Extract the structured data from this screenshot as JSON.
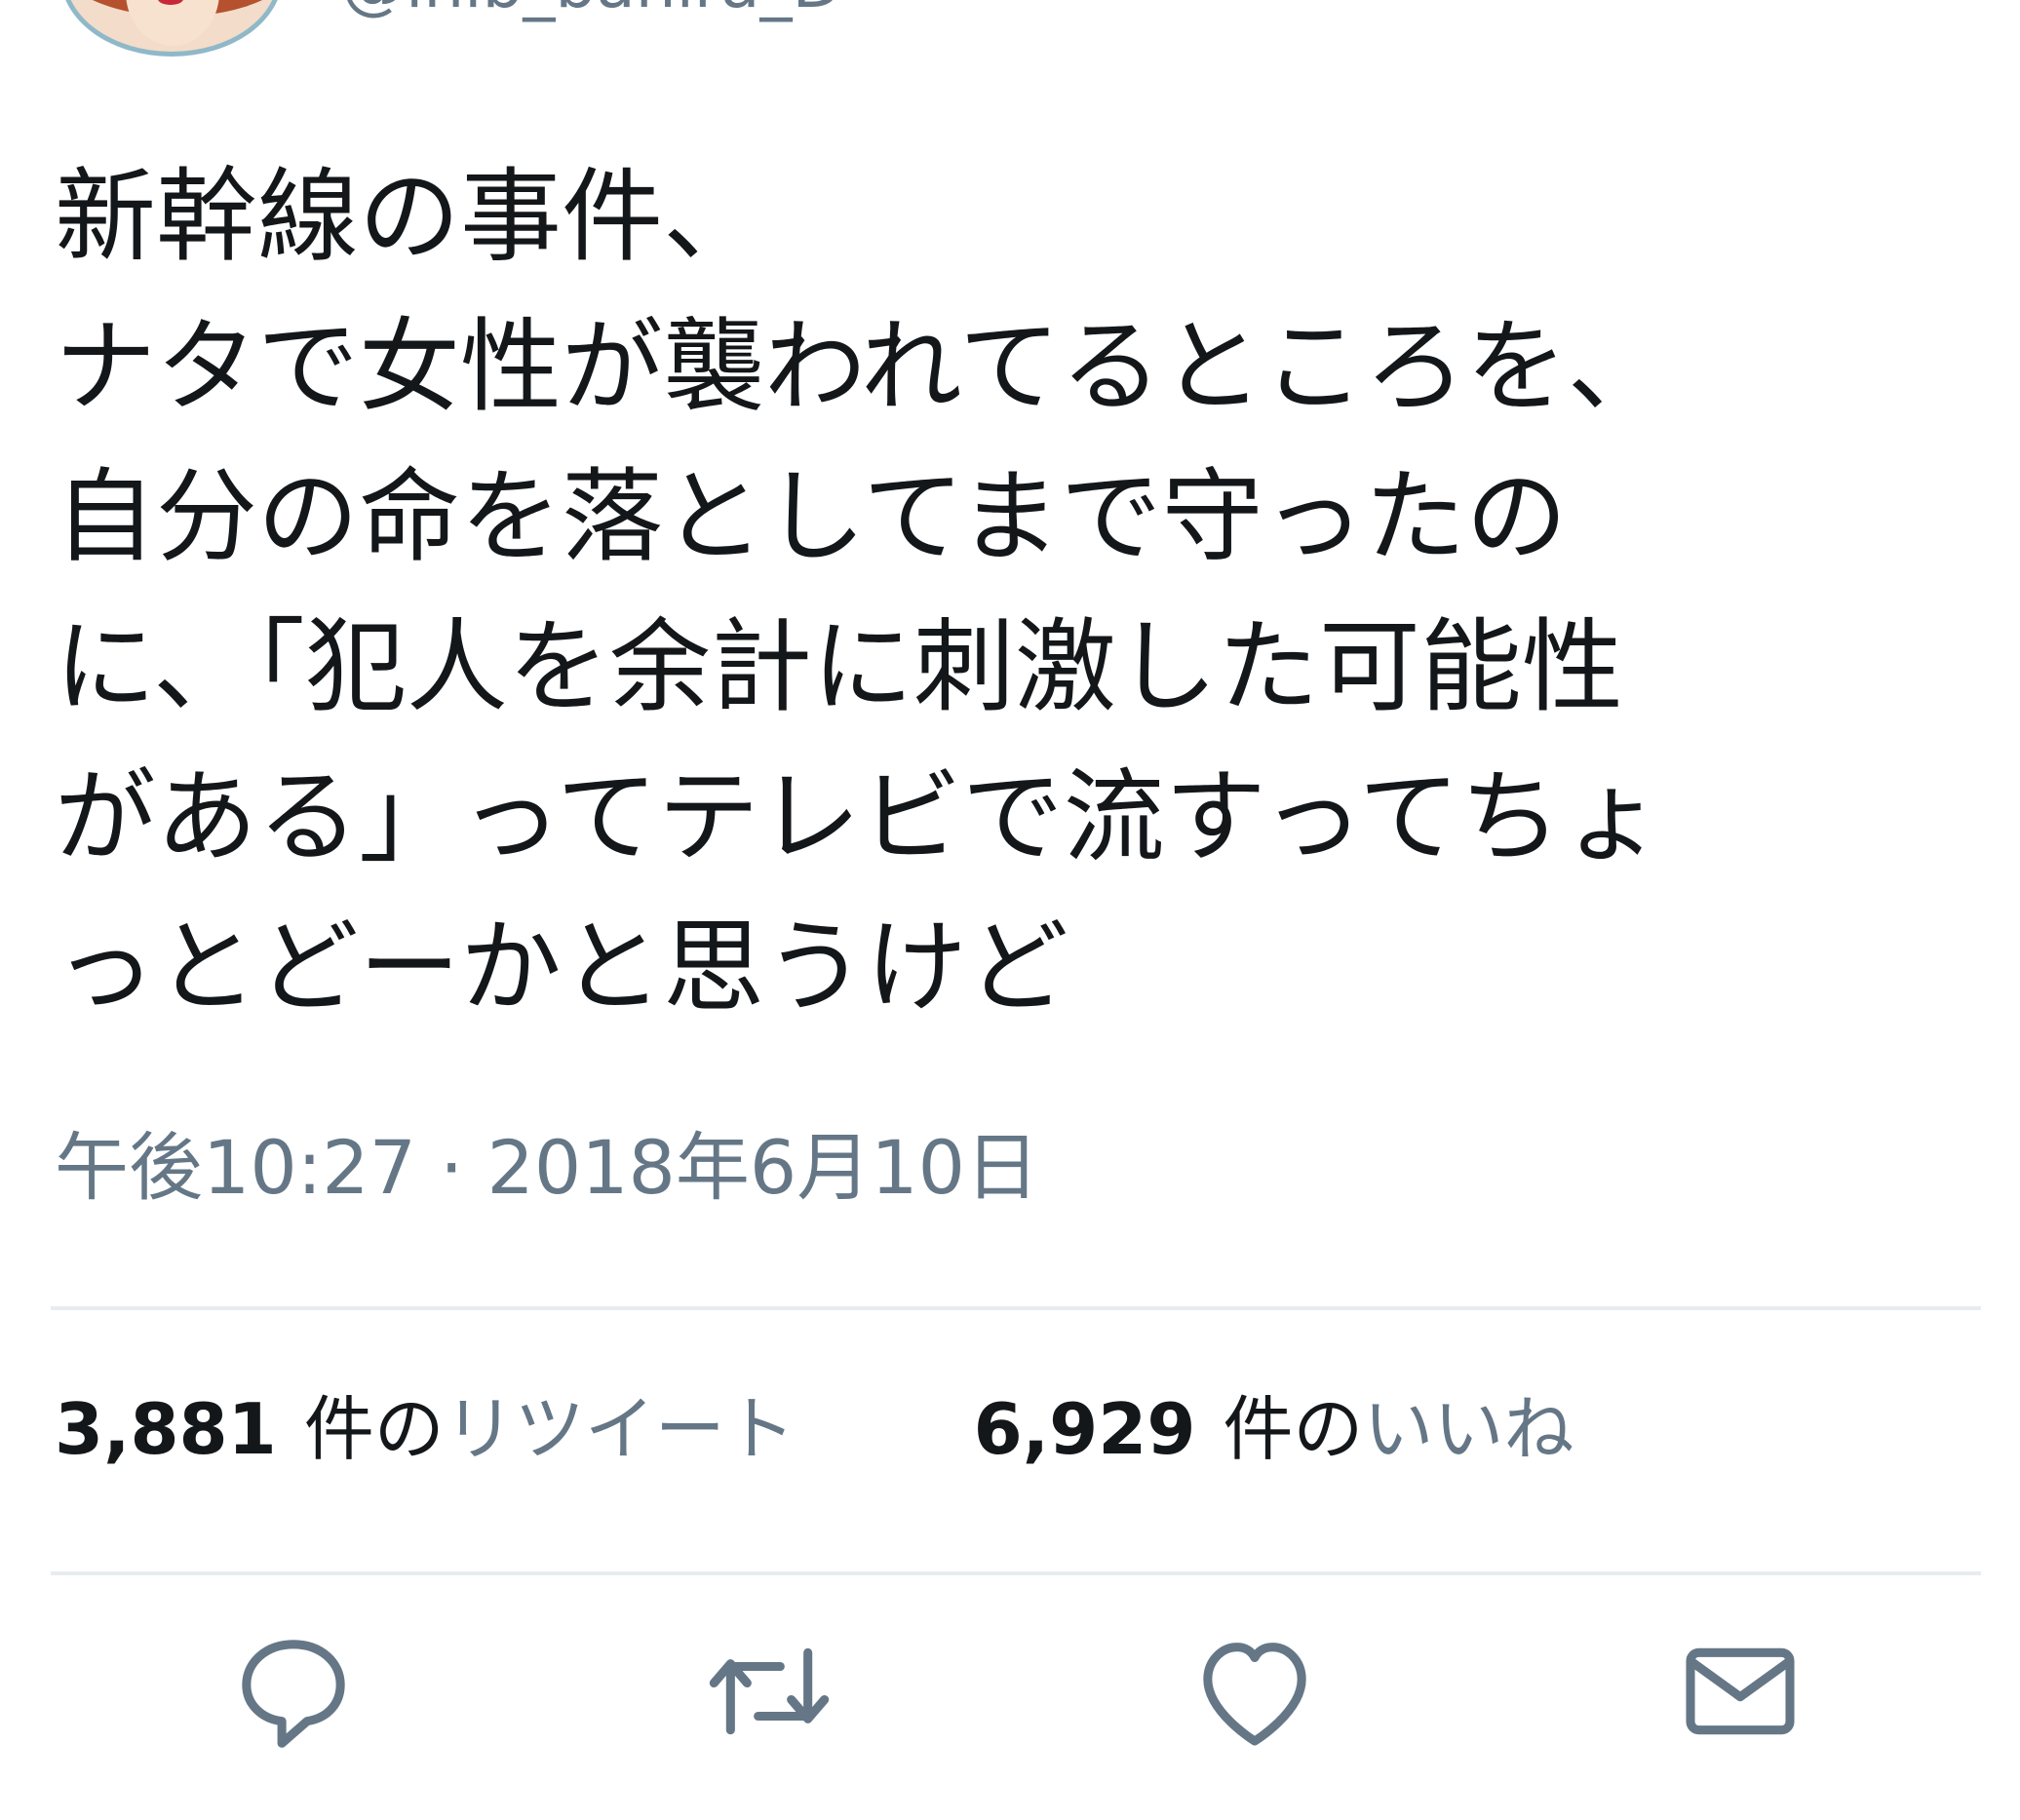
{
  "header": {
    "handle": "@inib_banira_D"
  },
  "tweet": {
    "lines": [
      "新幹線の事件、",
      "ナタで女性が襲われてるところを、",
      "自分の命を落としてまで守ったの",
      "に、「犯人を余計に刺激した可能性",
      "がある」ってテレビで流すってちょ",
      "っとどーかと思うけど"
    ],
    "timestamp": "午後10:27 · 2018年6月10日"
  },
  "stats": {
    "retweets": {
      "count": "3,881",
      "unit": "件の",
      "label": "リツイート"
    },
    "likes": {
      "count": "6,929",
      "unit": "件の",
      "label": "いいね"
    }
  },
  "actions": {
    "reply": "reply-icon",
    "retweet": "retweet-icon",
    "like": "heart-icon",
    "share": "envelope-icon"
  },
  "colors": {
    "text": "#14171a",
    "secondary": "#657786",
    "divider": "#e6ecf0"
  }
}
